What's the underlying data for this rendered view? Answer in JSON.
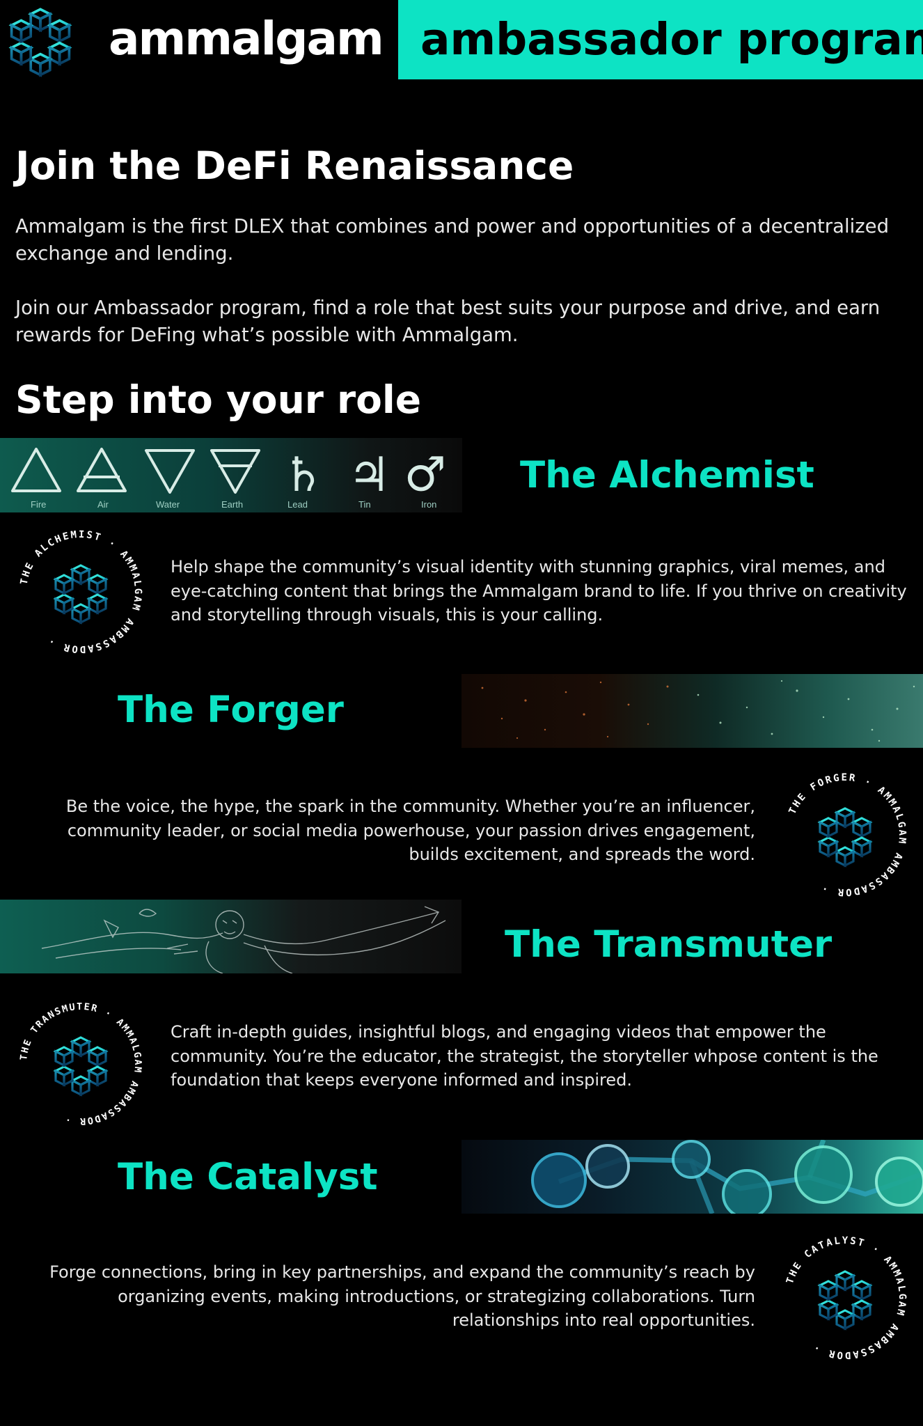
{
  "brand": {
    "name": "ammalgam",
    "banner": "ambassador program"
  },
  "intro": {
    "title": "Join the DeFi Renaissance",
    "p1": "Ammalgam is the first DLEX that combines and power and opportunities of a decentralized exchange and lending.",
    "p2": "Join our Ambassador program, find a role that best suits your purpose and drive, and earn rewards for DeFing what’s possible with Ammalgam."
  },
  "roles_heading": "Step into your role",
  "roles": [
    {
      "title": "The Alchemist",
      "badge_text": "THE ALCHEMIST · AMMALGAM AMBASSADOR ·",
      "description": "Help shape the community’s visual identity with stunning graphics, viral memes, and eye-catching content that brings the Ammalgam brand to life. If you thrive on creativity and storytelling through visuals, this is your calling.",
      "symbols": [
        {
          "glyph": "△",
          "label": "Fire"
        },
        {
          "glyph": "🜁",
          "label": "Air"
        },
        {
          "glyph": "▽",
          "label": "Water"
        },
        {
          "glyph": "🜃",
          "label": "Earth"
        },
        {
          "glyph": "♄",
          "label": "Lead"
        },
        {
          "glyph": "♃",
          "label": "Tin"
        },
        {
          "glyph": "♂",
          "label": "Iron"
        }
      ]
    },
    {
      "title": "The Forger",
      "badge_text": "THE FORGER · AMMALGAM AMBASSADOR ·",
      "description": "Be the voice, the hype, the spark in the community. Whether you’re an influencer, community leader, or social media powerhouse,  your passion drives engagement, builds excitement, and spreads the word."
    },
    {
      "title": "The Transmuter",
      "badge_text": "THE TRANSMUTER · AMMALGAM AMBASSADOR ·",
      "description": "Craft in-depth guides, insightful blogs, and engaging videos that empower the community. You’re the educator, the strategist, the storyteller whpose content is the foundation that keeps everyone informed and inspired."
    },
    {
      "title": "The Catalyst",
      "badge_text": "THE CATALYST · AMMALGAM AMBASSADOR ·",
      "description": "Forge connections, bring in key partnerships, and expand the community’s reach by organizing events, making introductions, or strategizing collaborations. Turn relationships into real opportunities."
    }
  ],
  "colors": {
    "accent": "#0de3c4",
    "background": "#000000",
    "text": "#ffffff",
    "banner_text": "#000000"
  }
}
